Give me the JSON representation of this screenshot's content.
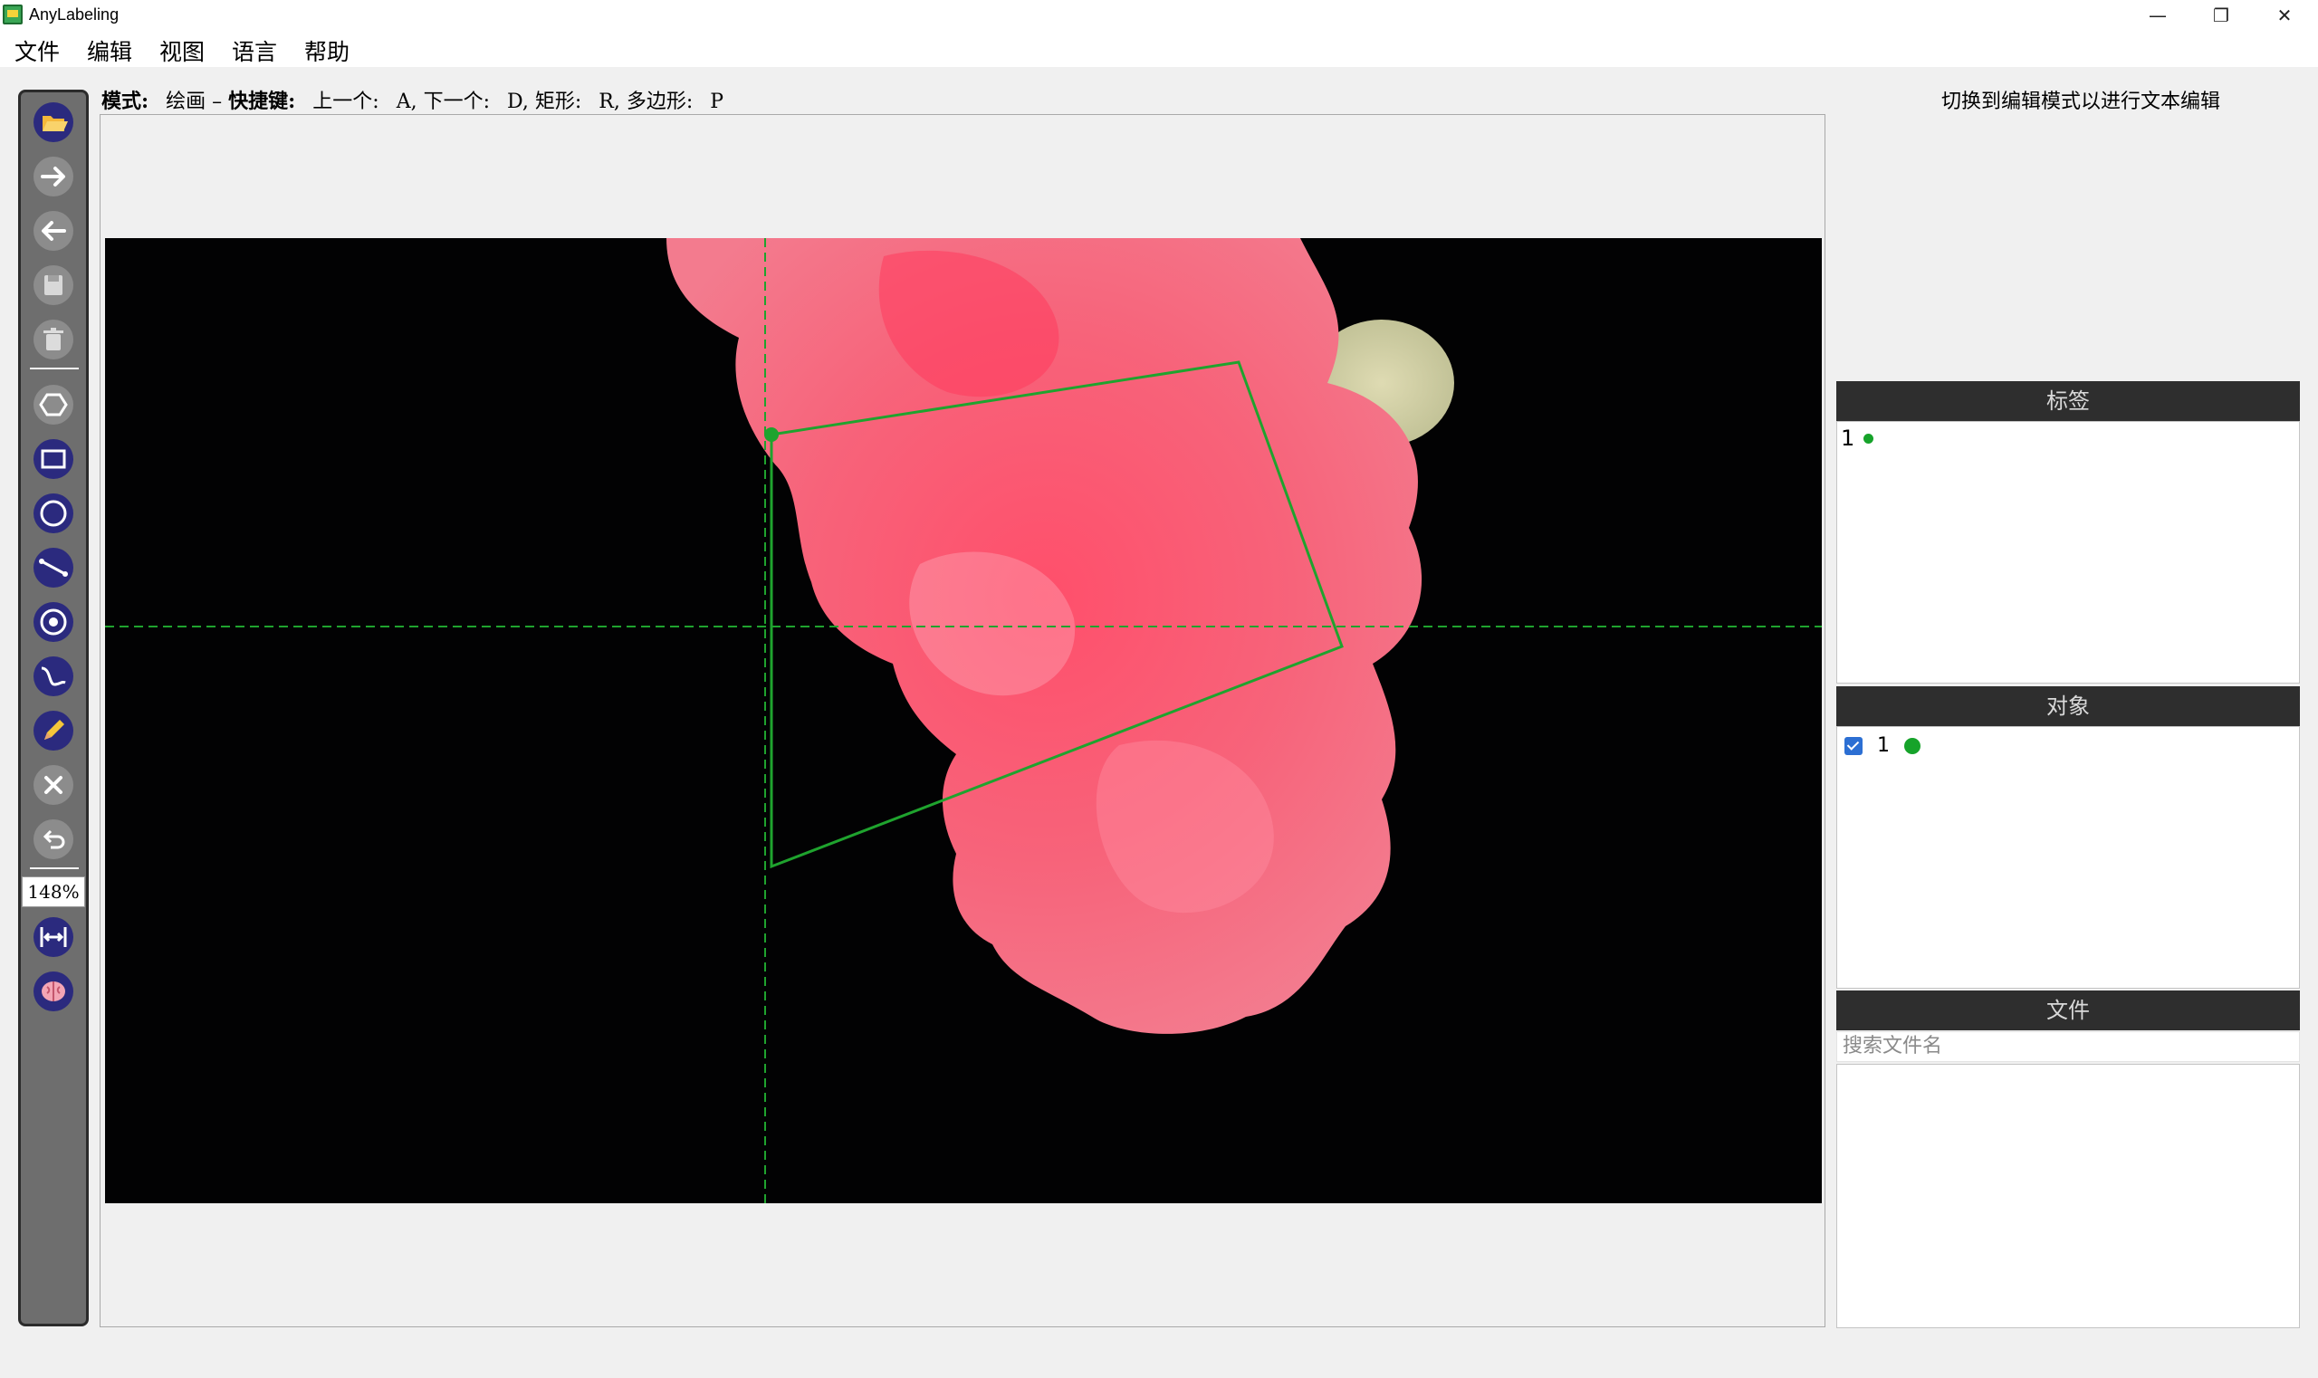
{
  "window": {
    "title": "AnyLabeling",
    "minimize": "—",
    "restore": "❐",
    "close": "✕"
  },
  "menu": [
    "文件",
    "编辑",
    "视图",
    "语言",
    "帮助"
  ],
  "hint": {
    "mode_label": "模式:",
    "mode_value": "绘画",
    "dash": "–",
    "shortcut_label": "快捷键:",
    "prev": "上一个:",
    "prev_key": "A,",
    "next": "下一个:",
    "next_key": "D,",
    "rect": "矩形:",
    "rect_key": "R,",
    "poly": "多边形:",
    "poly_key": "P"
  },
  "toolbar": {
    "zoom": "148%",
    "tools": [
      "open-folder-icon",
      "next-image-icon",
      "prev-image-icon",
      "save-icon",
      "delete-icon",
      "polygon-icon",
      "rectangle-icon",
      "circle-icon",
      "line-icon",
      "point-icon",
      "linestrip-icon",
      "edit-pencil-icon",
      "cancel-icon",
      "undo-icon",
      "fit-width-icon",
      "auto-label-brain-icon"
    ]
  },
  "right_panel": {
    "mode_hint": "切换到编辑模式以进行文本编辑",
    "labels_header": "标签",
    "labels": [
      {
        "name": "1",
        "color": "#16a32a"
      }
    ],
    "objects_header": "对象",
    "objects": [
      {
        "name": "1",
        "color": "#16a32a",
        "checked": true
      }
    ],
    "files_header": "文件",
    "search_placeholder": "搜索文件名"
  },
  "colors": {
    "shape": "#1fa32e",
    "accent_checkbox": "#2c6fd3",
    "toolbar_bg": "#6e6e6e",
    "icon_bg": "#2b2a7e"
  }
}
